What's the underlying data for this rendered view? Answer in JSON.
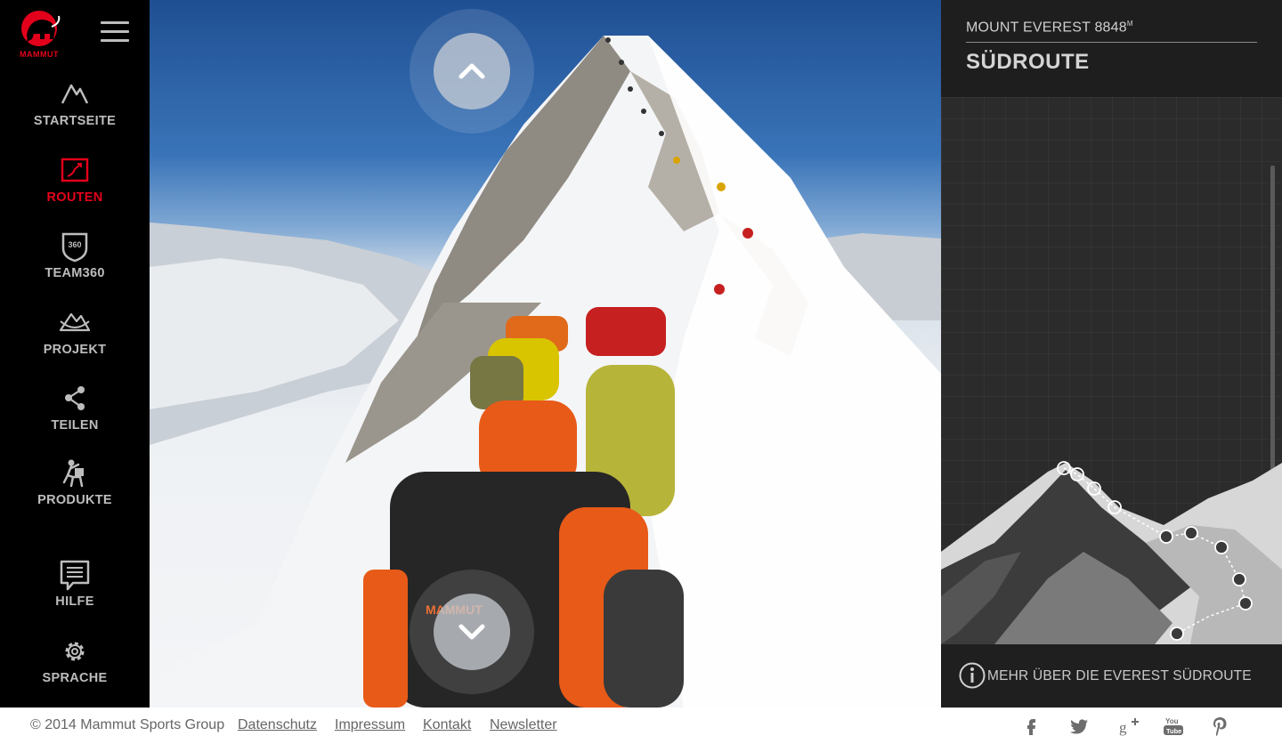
{
  "brand": {
    "logo_text": "MAMMUT",
    "accent": "#e3001b"
  },
  "sidebar": {
    "menu_icon": "hamburger-icon",
    "items": [
      {
        "label": "STARTSEITE",
        "icon": "mountain-icon",
        "active": false
      },
      {
        "label": "ROUTEN",
        "icon": "route-icon",
        "active": true
      },
      {
        "label": "TEAM360",
        "icon": "team360-badge-icon",
        "active": false
      },
      {
        "label": "PROJEKT",
        "icon": "project-icon",
        "active": false
      },
      {
        "label": "TEILEN",
        "icon": "share-icon",
        "active": false
      },
      {
        "label": "PRODUKTE",
        "icon": "climber-icon",
        "active": false
      },
      {
        "label": "HILFE",
        "icon": "help-icon",
        "active": false
      },
      {
        "label": "SPRACHE",
        "icon": "gear-icon",
        "active": false
      }
    ]
  },
  "main": {
    "scroll_up_icon": "chevron-up-icon",
    "scroll_down_icon": "chevron-down-icon",
    "backpack_brand": "MAMMUT"
  },
  "panel": {
    "mountain": "MOUNT EVEREST 8848",
    "mountain_unit": "M",
    "route": "SÜDROUTE",
    "info_link": "MEHR ÜBER DIE EVEREST SÜDROUTE",
    "info_icon": "info-icon"
  },
  "footer": {
    "copyright": "© 2014 Mammut Sports Group",
    "links": [
      "Datenschutz",
      "Impressum",
      "Kontakt",
      "Newsletter"
    ],
    "social": [
      "facebook-icon",
      "twitter-icon",
      "google-plus-icon",
      "youtube-icon",
      "pinterest-icon"
    ]
  }
}
